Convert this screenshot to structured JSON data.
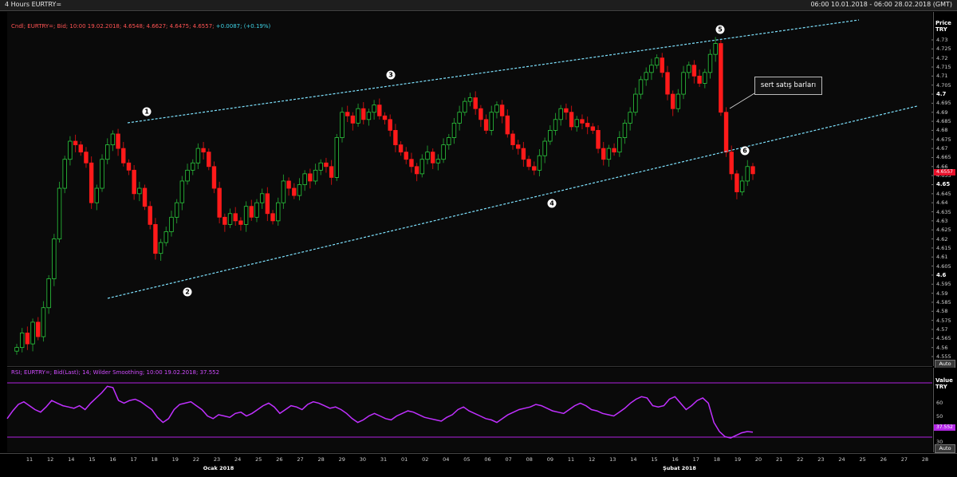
{
  "window": {
    "title": "4 Hours EURTRY=",
    "range": "06:00 10.01.2018 - 06:00 28.02.2018 (GMT)"
  },
  "price_pane": {
    "legend_main": "Cndl; EURTRY=; Bid; 10:00 19.02.2018; 4.6548; 4.6627; 4.6475; 4.6557;",
    "legend_change": "+0.0087; (+0.19%)",
    "axis_title_1": "Price",
    "axis_title_2": "TRY",
    "current_price": "4.6557",
    "auto_label": "Auto",
    "ticks": [
      "4.73",
      "4.725",
      "4.72",
      "4.715",
      "4.71",
      "4.705",
      "4.7",
      "4.695",
      "4.69",
      "4.685",
      "4.68",
      "4.675",
      "4.67",
      "4.665",
      "4.66",
      "4.655",
      "4.65",
      "4.645",
      "4.64",
      "4.635",
      "4.63",
      "4.625",
      "4.62",
      "4.615",
      "4.61",
      "4.605",
      "4.6",
      "4.595",
      "4.59",
      "4.585",
      "4.58",
      "4.575",
      "4.57",
      "4.565",
      "4.56",
      "4.555"
    ],
    "annotation": "sert satış barları",
    "wave_labels": [
      "1",
      "2",
      "3",
      "4",
      "5",
      "6"
    ]
  },
  "rsi_pane": {
    "legend": "RSI; EURTRY=; Bid(Last); 14; Wilder Smoothing; 10:00 19.02.2018; 37.552",
    "axis_title_1": "Value",
    "axis_title_2": "TRY",
    "current_value": "37.552",
    "auto_label": "Auto",
    "ticks": [
      "60",
      "50",
      "40",
      "30"
    ]
  },
  "x_axis": {
    "days": [
      "11",
      "12",
      "14",
      "15",
      "16",
      "17",
      "18",
      "19",
      "22",
      "23",
      "24",
      "25",
      "26",
      "27",
      "28",
      "29",
      "30",
      "31",
      "01",
      "02",
      "04",
      "05",
      "06",
      "07",
      "08",
      "09",
      "11",
      "12",
      "13",
      "14",
      "15",
      "16",
      "17",
      "18",
      "19",
      "20",
      "21",
      "22",
      "23",
      "24",
      "25",
      "26",
      "27",
      "28"
    ],
    "months": [
      "Ocak 2018",
      "Şubat 2018"
    ]
  },
  "colors": {
    "up": "#2ecc40",
    "down": "#ff1a1a",
    "trend": "#7fe3ff",
    "rsi": "#c030ff"
  },
  "chart_data": {
    "type": "candlestick",
    "symbol": "EURTRY=",
    "ylim": [
      4.55,
      4.735
    ],
    "closes": [
      4.56,
      4.568,
      4.562,
      4.574,
      4.566,
      4.582,
      4.598,
      4.62,
      4.648,
      4.664,
      4.674,
      4.672,
      4.668,
      4.662,
      4.64,
      4.648,
      4.664,
      4.672,
      4.678,
      4.67,
      4.662,
      4.658,
      4.645,
      4.648,
      4.638,
      4.628,
      4.612,
      4.618,
      4.624,
      4.632,
      4.64,
      4.652,
      4.658,
      4.662,
      4.67,
      4.668,
      4.66,
      4.648,
      4.632,
      4.628,
      4.634,
      4.63,
      4.628,
      4.638,
      4.632,
      4.64,
      4.645,
      4.634,
      4.63,
      4.64,
      4.652,
      4.648,
      4.644,
      4.65,
      4.656,
      4.652,
      4.658,
      4.662,
      4.66,
      4.654,
      4.676,
      4.69,
      4.688,
      4.684,
      4.692,
      4.686,
      4.69,
      4.694,
      4.688,
      4.686,
      4.68,
      4.672,
      4.668,
      4.664,
      4.66,
      4.656,
      4.664,
      4.668,
      4.662,
      4.664,
      4.672,
      4.676,
      4.684,
      4.69,
      4.696,
      4.698,
      4.692,
      4.686,
      4.68,
      4.69,
      4.694,
      4.688,
      4.678,
      4.672,
      4.67,
      4.664,
      4.66,
      4.658,
      4.666,
      4.674,
      4.68,
      4.686,
      4.692,
      4.69,
      4.682,
      4.686,
      4.684,
      4.682,
      4.68,
      4.67,
      4.664,
      4.67,
      4.668,
      4.676,
      4.684,
      4.69,
      4.7,
      4.708,
      4.712,
      4.716,
      4.72,
      4.712,
      4.7,
      4.692,
      4.7,
      4.712,
      4.716,
      4.71,
      4.706,
      4.712,
      4.722,
      4.728,
      4.69,
      4.668,
      4.656,
      4.646,
      4.652,
      4.66,
      4.656
    ],
    "rsi": [
      48,
      54,
      59,
      61,
      58,
      55,
      53,
      57,
      62,
      60,
      58,
      57,
      56,
      58,
      55,
      60,
      64,
      68,
      73,
      72,
      62,
      60,
      62,
      63,
      61,
      58,
      55,
      49,
      45,
      48,
      55,
      59,
      60,
      61,
      58,
      55,
      50,
      48,
      51,
      50,
      49,
      52,
      53,
      50,
      52,
      55,
      58,
      60,
      57,
      52,
      55,
      58,
      57,
      55,
      59,
      61,
      60,
      58,
      56,
      57,
      55,
      52,
      48,
      45,
      47,
      50,
      52,
      50,
      48,
      47,
      50,
      52,
      54,
      53,
      51,
      49,
      48,
      47,
      46,
      49,
      51,
      55,
      57,
      54,
      52,
      50,
      48,
      47,
      45,
      48,
      51,
      53,
      55,
      56,
      57,
      59,
      58,
      56,
      54,
      53,
      52,
      55,
      58,
      60,
      58,
      55,
      54,
      52,
      51,
      50,
      53,
      56,
      60,
      63,
      65,
      64,
      58,
      57,
      58,
      63,
      65,
      60,
      55,
      58,
      62,
      64,
      60,
      45,
      38,
      34,
      33,
      35,
      37,
      38,
      37.552
    ]
  }
}
